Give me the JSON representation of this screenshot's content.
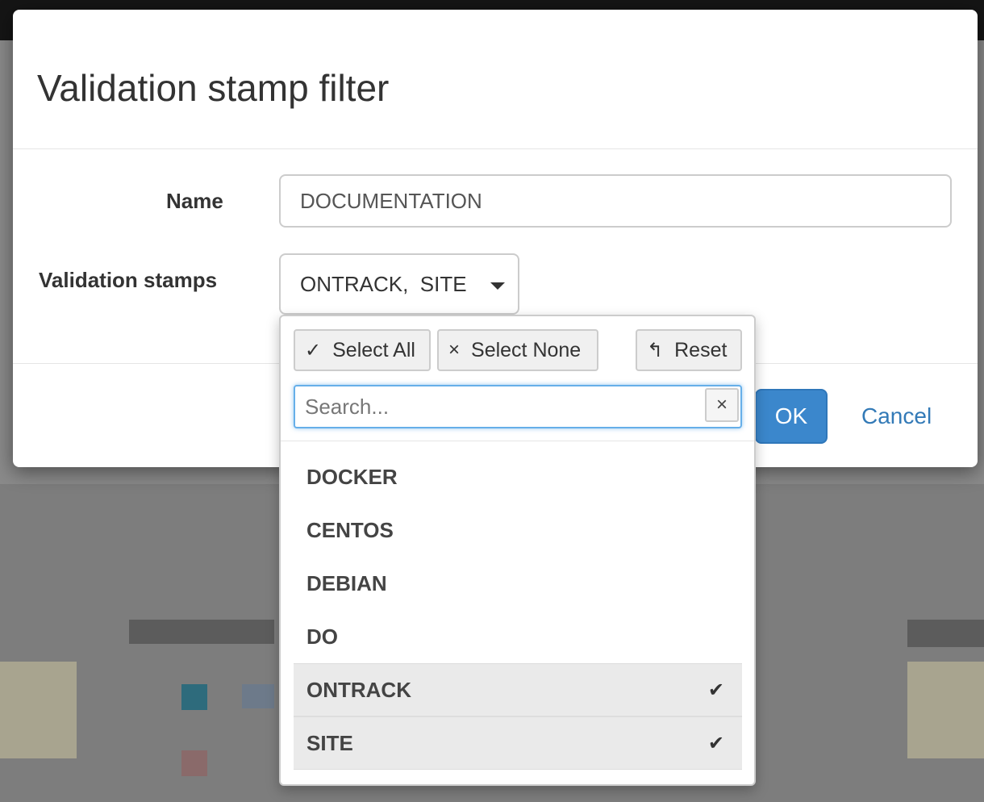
{
  "modal": {
    "title": "Validation stamp filter",
    "name_label": "Name",
    "name_value": "DOCUMENTATION",
    "stamps_label": "Validation stamps",
    "stamps_selected_text": "ONTRACK,  SITE",
    "ok_label": "OK",
    "cancel_label": "Cancel"
  },
  "dropdown": {
    "select_all_icon": "✓",
    "select_all_label": "Select All",
    "select_none_icon": "×",
    "select_none_label": "Select None",
    "reset_icon": "↰",
    "reset_label": "Reset",
    "search_placeholder": "Search...",
    "search_clear_icon": "×",
    "options": [
      {
        "label": "DOCKER",
        "selected": false
      },
      {
        "label": "CENTOS",
        "selected": false
      },
      {
        "label": "DEBIAN",
        "selected": false
      },
      {
        "label": "DO",
        "selected": false
      },
      {
        "label": "ONTRACK",
        "selected": true,
        "check": "✔"
      },
      {
        "label": "SITE",
        "selected": true,
        "check": "✔"
      }
    ]
  },
  "colors": {
    "primary": "#3b87cc",
    "link": "#337ab7",
    "focus": "#66afe9"
  }
}
